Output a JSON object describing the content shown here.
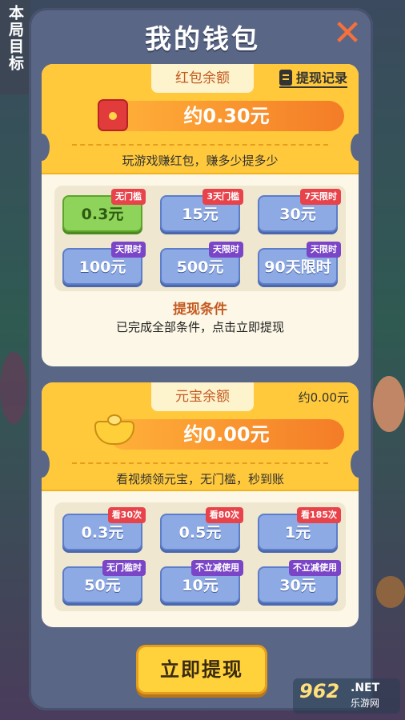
{
  "background": {
    "goal_label": "本局目标"
  },
  "title": "我的钱包",
  "close_icon": "close-icon",
  "red_packet": {
    "tab_label": "红包余额",
    "record_label": "提现记录",
    "amount": "约0.30元",
    "subtitle": "玩游戏赚红包，赚多少提多少",
    "options": [
      {
        "value": "0.3元",
        "badge": "无门槛",
        "badge_color": "#e8434a",
        "selected": true
      },
      {
        "value": "15元",
        "badge": "3天门槛",
        "badge_color": "#e8434a",
        "selected": false
      },
      {
        "value": "30元",
        "badge": "7天限时",
        "badge_color": "#e8434a",
        "selected": false
      },
      {
        "value": "100元",
        "badge": "天限时",
        "badge_color": "#7a45c7",
        "selected": false
      },
      {
        "value": "500元",
        "badge": "天限时",
        "badge_color": "#7a45c7",
        "selected": false
      },
      {
        "value": "90天限时",
        "badge": "天限时",
        "badge_color": "#7a45c7",
        "selected": false
      }
    ],
    "condition_title": "提现条件",
    "condition_text": "已完成全部条件，点击立即提现"
  },
  "ingot": {
    "tab_label": "元宝余额",
    "balance_small": "约0.00元",
    "amount": "约0.00元",
    "subtitle": "看视频领元宝，无门槛，秒到账",
    "options": [
      {
        "value": "0.3元",
        "badge": "看30次",
        "badge_color": "#e8434a"
      },
      {
        "value": "0.5元",
        "badge": "看80次",
        "badge_color": "#e8434a"
      },
      {
        "value": "1元",
        "badge": "看185次",
        "badge_color": "#e8434a"
      },
      {
        "value": "50元",
        "badge": "无门槛时",
        "badge_color": "#7a45c7"
      },
      {
        "value": "10元",
        "badge": "不立减使用",
        "badge_color": "#7a45c7"
      },
      {
        "value": "30元",
        "badge": "不立减使用",
        "badge_color": "#7a45c7"
      }
    ]
  },
  "withdraw_button": "立即提现",
  "watermark": {
    "big": "962",
    "net": ".NET",
    "cn": "乐游网"
  }
}
